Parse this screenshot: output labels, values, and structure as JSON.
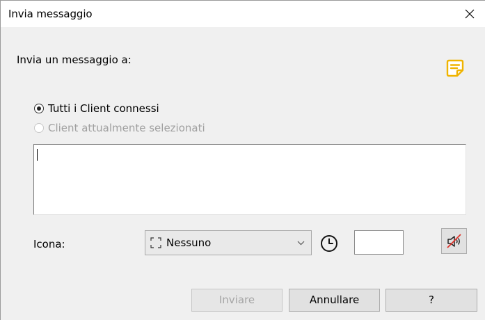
{
  "window": {
    "title": "Invia messaggio",
    "close_icon": "close-icon"
  },
  "form": {
    "send_to_label": "Invia un messaggio a:",
    "note_icon": "sticky-note-icon",
    "radio_all": {
      "label": "Tutti i Client connessi",
      "checked": true,
      "enabled": true
    },
    "radio_selected": {
      "label": "Client attualmente selezionati",
      "checked": false,
      "enabled": false
    },
    "message_value": "",
    "icon_label": "Icona:",
    "icon_select": {
      "value": "Nessuno",
      "glyph": "empty-frame-icon"
    },
    "timer_icon": "clock-icon",
    "timer_value": "",
    "sound_icon": "speaker-muted-icon"
  },
  "buttons": {
    "send": "Inviare",
    "cancel": "Annullare",
    "help": "?"
  },
  "colors": {
    "accent_note": "#f0b400",
    "mute_slash": "#e0322a"
  }
}
